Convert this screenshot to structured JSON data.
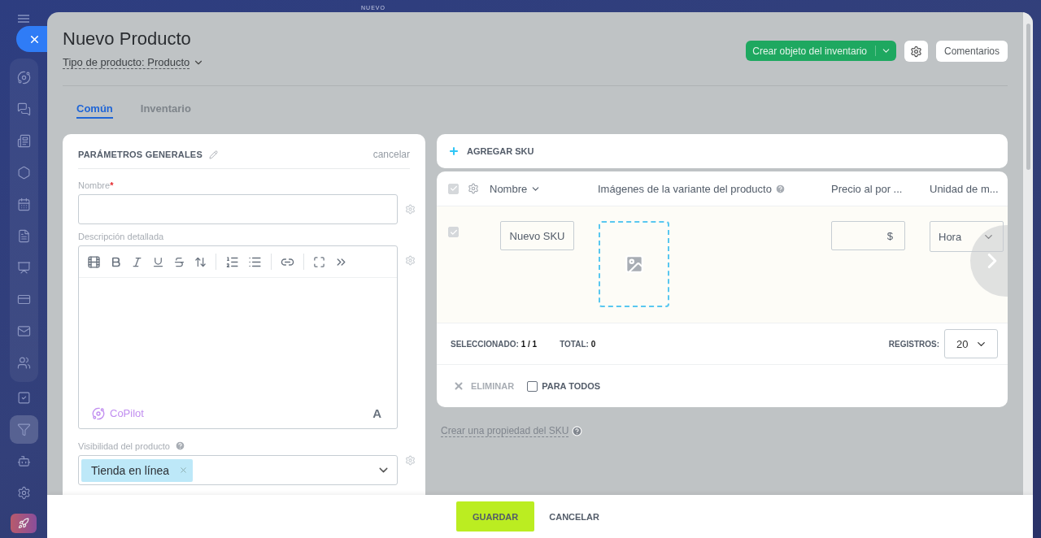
{
  "backdrop": {
    "label": "NUEVO"
  },
  "sidebar": {
    "items": [
      {
        "kind": "orbit",
        "selected": false
      },
      {
        "kind": "chats",
        "selected": false
      },
      {
        "kind": "news",
        "selected": false
      },
      {
        "kind": "hexagon",
        "selected": false
      },
      {
        "kind": "calendar",
        "selected": false
      },
      {
        "kind": "document",
        "selected": false
      },
      {
        "kind": "board",
        "selected": false
      },
      {
        "kind": "card",
        "selected": false
      },
      {
        "kind": "mail",
        "selected": false
      },
      {
        "kind": "users",
        "selected": false
      },
      {
        "kind": "tasks",
        "selected": false
      },
      {
        "kind": "funnel",
        "selected": true
      },
      {
        "kind": "bot",
        "selected": false
      },
      {
        "kind": "settings",
        "selected": false
      },
      {
        "kind": "rocket",
        "selected": false
      }
    ]
  },
  "window": {
    "title": "Nuevo Producto",
    "product_type": "Tipo de producto: Producto"
  },
  "header_buttons": {
    "primary": "Crear objeto del inventario",
    "comments": "Comentarios"
  },
  "tabs": [
    {
      "label": "Común",
      "selected": true
    },
    {
      "label": "Inventario",
      "selected": false
    }
  ],
  "general": {
    "title": "PARÁMETROS GENERALES",
    "cancel": "cancelar",
    "name_label": "Nombre",
    "name_required": true,
    "required_mark": "*",
    "description_label": "Descripción detallada",
    "copilot": "CoPilot",
    "font_button": "A",
    "visibility_label": "Visibilidad del producto",
    "visibility_tags": [
      "Tienda en línea"
    ]
  },
  "sku": {
    "add": "AGREGAR SKU",
    "columns": [
      "Nombre",
      "Imágenes de la variante del producto",
      "Precio al por ...",
      "Unidad de m..."
    ],
    "select_all_checked": true,
    "rows": [
      {
        "checked": true,
        "name": "Nuevo SKU",
        "currency": "$",
        "unit": "Hora"
      }
    ],
    "selected_label": "SELECCIONADO:",
    "selected_value": "1 / 1",
    "total_label": "TOTAL:",
    "total_value": "0",
    "records_label": "REGISTROS:",
    "records_value": "20",
    "delete": "ELIMINAR",
    "for_all": "PARA TODOS",
    "for_all_checked": false,
    "create_property": "Crear una propiedad del SKU"
  },
  "footer": {
    "save": "GUARDAR",
    "cancel": "CANCELAR"
  }
}
